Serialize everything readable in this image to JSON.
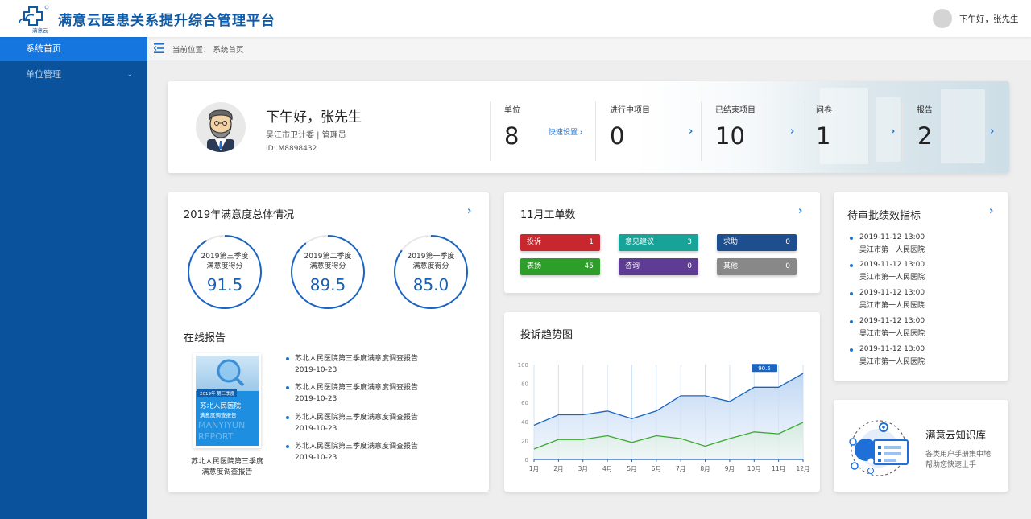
{
  "header": {
    "logo_text": "满意云",
    "app_title": "满意云医患关系提升综合管理平台",
    "user_greeting": "下午好，张先生"
  },
  "sidebar": {
    "items": [
      {
        "label": "系统首页"
      },
      {
        "label": "单位管理"
      }
    ]
  },
  "breadcrumb": {
    "text": "当前位置：  系统首页"
  },
  "welcome": {
    "greeting": "下午好，张先生",
    "org_role": "吴江市卫计委 | 管理员",
    "id_text": "ID: M8898432",
    "stats": [
      {
        "label": "单位",
        "value": "8",
        "link": "快速设置"
      },
      {
        "label": "进行中项目",
        "value": "0"
      },
      {
        "label": "已结束项目",
        "value": "10"
      },
      {
        "label": "问卷",
        "value": "1"
      },
      {
        "label": "报告",
        "value": "2"
      }
    ]
  },
  "satisfaction": {
    "title": "2019年满意度总体情况",
    "items": [
      {
        "line1": "2019第三季度",
        "line2": "满意度得分",
        "score": "91.5",
        "value": 91.5
      },
      {
        "line1": "2019第二季度",
        "line2": "满意度得分",
        "score": "89.5",
        "value": 89.5
      },
      {
        "line1": "2019第一季度",
        "line2": "满意度得分",
        "score": "85.0",
        "value": 85.0
      }
    ]
  },
  "online_reports": {
    "title": "在线报告",
    "cover": {
      "badge": "2019年 第三季度",
      "hospital": "苏北人民医院",
      "subtitle": "满意度调查报告",
      "watermark1": "MANYIYUN",
      "watermark2": "REPORT",
      "caption_line1": "苏北人民医院第三季度",
      "caption_line2": "满意度调查报告"
    },
    "list": [
      {
        "title": "苏北人民医院第三季度满意度调查报告",
        "date": "2019-10-23"
      },
      {
        "title": "苏北人民医院第三季度满意度调查报告",
        "date": "2019-10-23"
      },
      {
        "title": "苏北人民医院第三季度满意度调查报告",
        "date": "2019-10-23"
      },
      {
        "title": "苏北人民医院第三季度满意度调查报告",
        "date": "2019-10-23"
      }
    ]
  },
  "work_orders": {
    "title": "11月工单数",
    "items": [
      {
        "label": "投诉",
        "count": "1",
        "color": "#c8272d"
      },
      {
        "label": "意见建议",
        "count": "3",
        "color": "#17a398"
      },
      {
        "label": "求助",
        "count": "0",
        "color": "#1d4f8e"
      },
      {
        "label": "表扬",
        "count": "45",
        "color": "#2e9e2a"
      },
      {
        "label": "咨询",
        "count": "0",
        "color": "#5f3c93"
      },
      {
        "label": "其他",
        "count": "0",
        "color": "#888888"
      }
    ]
  },
  "trend": {
    "title": "投诉趋势图"
  },
  "chart_data": {
    "type": "area",
    "title": "投诉趋势图",
    "categories": [
      "1月",
      "2月",
      "3月",
      "4月",
      "5月",
      "6月",
      "7月",
      "8月",
      "9月",
      "10月",
      "11月",
      "12月"
    ],
    "series": [
      {
        "values": [
          36,
          47,
          47,
          51,
          43,
          51,
          67,
          67,
          61,
          76,
          76,
          90.5
        ],
        "color": "#1a64c2"
      },
      {
        "values": [
          11,
          21,
          21,
          25,
          18,
          25,
          22,
          14,
          22,
          29,
          27,
          39
        ],
        "color": "#3caa2f"
      }
    ],
    "ylim": [
      0,
      100
    ],
    "yticks": [
      "100",
      "80",
      "60",
      "40",
      "20",
      "0"
    ],
    "annotation": "90.5",
    "grid": "vertical"
  },
  "pending": {
    "title": "待审批绩效指标",
    "items": [
      {
        "time": "2019-11-12  13:00",
        "org": "吴江市第一人民医院"
      },
      {
        "time": "2019-11-12  13:00",
        "org": "吴江市第一人民医院"
      },
      {
        "time": "2019-11-12  13:00",
        "org": "吴江市第一人民医院"
      },
      {
        "time": "2019-11-12  13:00",
        "org": "吴江市第一人民医院"
      },
      {
        "time": "2019-11-12  13:00",
        "org": "吴江市第一人民医院"
      }
    ]
  },
  "knowledge": {
    "title": "满意云知识库",
    "desc1": "各类用户手册集中地",
    "desc2": "帮助您快速上手"
  },
  "colors": {
    "primary": "#1a73d1",
    "sidebar": "#0a529c",
    "sidebar_active": "#1576e0"
  }
}
